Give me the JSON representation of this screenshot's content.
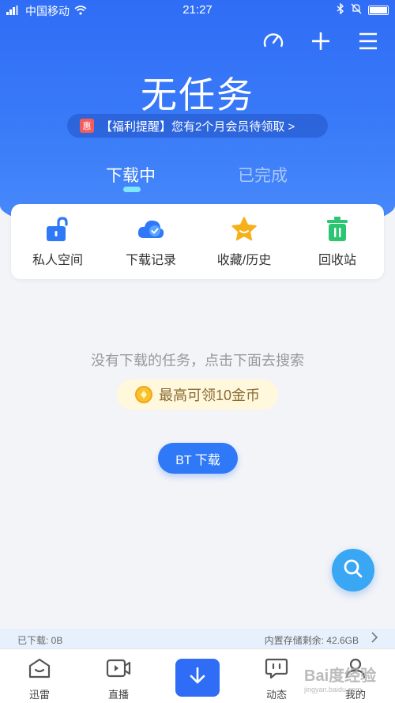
{
  "status": {
    "carrier": "中国移动",
    "time": "21:27"
  },
  "header": {
    "title": "无任务",
    "promo_tag": "惠",
    "promo_text": "【福利提醒】您有2个月会员待领取 >",
    "icons": [
      "speedometer-icon",
      "plus-icon",
      "menu-icon"
    ]
  },
  "tabs": [
    {
      "label": "下载中",
      "active": true
    },
    {
      "label": "已完成",
      "active": false
    }
  ],
  "shortcuts": [
    {
      "label": "私人空间",
      "icon": "lock-icon",
      "color": "#2f78f7"
    },
    {
      "label": "下载记录",
      "icon": "cloud-check-icon",
      "color": "#2f78f7"
    },
    {
      "label": "收藏/历史",
      "icon": "star-icon",
      "color": "#f6b019"
    },
    {
      "label": "回收站",
      "icon": "trash-icon",
      "color": "#2cc673"
    }
  ],
  "empty": {
    "message": "没有下载的任务，点击下面去搜索",
    "coin_text": "最高可领10金币",
    "bt_button": "BT 下载"
  },
  "storage": {
    "downloaded": "已下载: 0B",
    "free": "内置存储剩余: 42.6GB"
  },
  "bottom_nav": [
    {
      "label": "迅雷",
      "icon": "home-icon"
    },
    {
      "label": "直播",
      "icon": "video-icon"
    },
    {
      "label": "",
      "icon": "download-icon"
    },
    {
      "label": "动态",
      "icon": "chat-icon"
    },
    {
      "label": "我的",
      "icon": "user-icon"
    }
  ],
  "watermark": {
    "brand": "Bai度经验",
    "url": "jingyan.baidu.com"
  }
}
